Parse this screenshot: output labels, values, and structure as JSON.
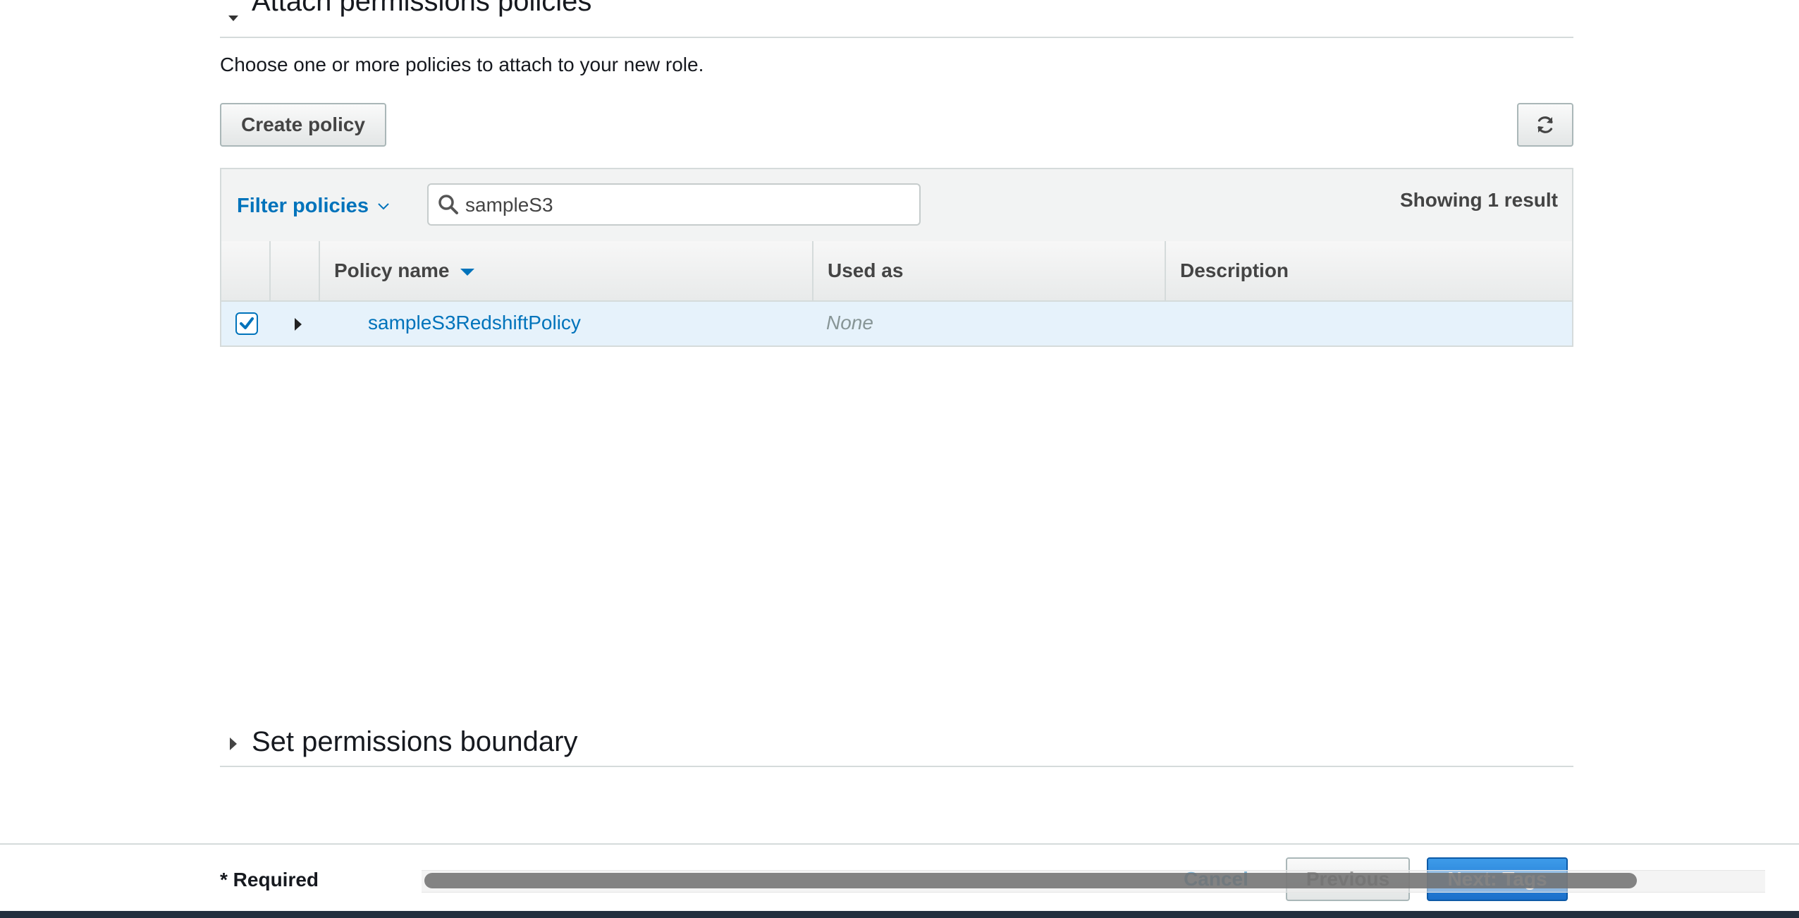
{
  "section": {
    "title": "Attach permissions policies",
    "subtitle": "Choose one or more policies to attach to your new role."
  },
  "actions": {
    "create_policy_label": "Create policy",
    "refresh_icon": "refresh-icon"
  },
  "filter": {
    "label": "Filter policies",
    "search_value": "sampleS3",
    "search_icon": "search-icon"
  },
  "results": {
    "showing": "Showing 1 result"
  },
  "table": {
    "columns": [
      "Policy name",
      "Used as",
      "Description"
    ],
    "rows": [
      {
        "checked": true,
        "name": "sampleS3RedshiftPolicy",
        "used_as": "None",
        "description": ""
      }
    ]
  },
  "boundary": {
    "title": "Set permissions boundary"
  },
  "footer": {
    "required": "* Required",
    "cancel": "Cancel",
    "previous": "Previous",
    "next": "Next: Tags"
  },
  "colors": {
    "link": "#0073bb",
    "primary_button": "#1a6fcb",
    "selected_row": "#e6f2fb"
  }
}
